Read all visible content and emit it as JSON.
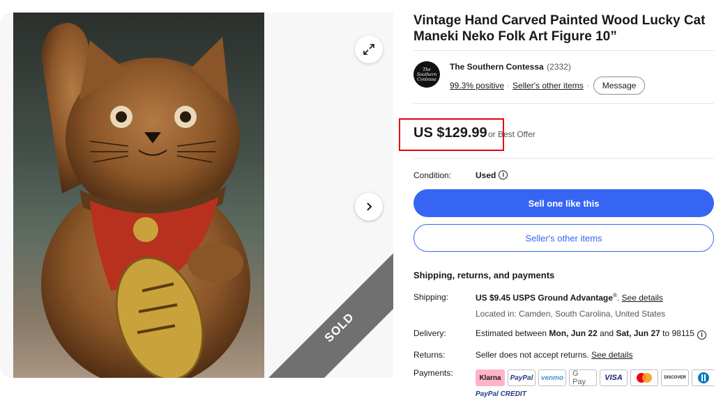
{
  "listing": {
    "title": "Vintage Hand Carved Painted Wood Lucky Cat Maneki Neko Folk Art Figure 10”",
    "sold_label": "SOLD"
  },
  "seller": {
    "logo_text": "The Southern Contessa",
    "name": "The Southern Contessa",
    "feedback_count": "(2332)",
    "positive": "99.3% positive",
    "other_items_link": "Seller's other items",
    "message_button": "Message"
  },
  "price": {
    "amount": "US $129.99",
    "offer_text": "or Best Offer"
  },
  "condition": {
    "label": "Condition:",
    "value": "Used"
  },
  "actions": {
    "sell_one": "Sell one like this",
    "seller_items": "Seller's other items"
  },
  "shipping_section": {
    "title": "Shipping, returns, and payments",
    "shipping_label": "Shipping:",
    "shipping_value": "US $9.45 USPS Ground Advantage",
    "shipping_reg": "®",
    "shipping_period": ".",
    "see_details": "See details",
    "location": "Located in: Camden, South Carolina, United States",
    "delivery_label": "Delivery:",
    "delivery_prefix": "Estimated between ",
    "delivery_start": "Mon, Jun 22",
    "delivery_and": " and ",
    "delivery_end": "Sat, Jun 27",
    "delivery_suffix": " to 98115",
    "returns_label": "Returns:",
    "returns_value": "Seller does not accept returns.",
    "returns_details": "See details",
    "payments_label": "Payments:",
    "payment_methods": [
      "Klarna",
      "PayPal",
      "venmo",
      "G Pay",
      "VISA",
      "Mastercard",
      "DISCOVER",
      "Diners"
    ],
    "paypal_credit": "PayPal CREDIT"
  },
  "icons": {
    "expand": "expand-icon",
    "next": "chevron-right-icon",
    "info": "info-icon"
  },
  "colors": {
    "primary": "#3665f3",
    "highlight": "#e60012",
    "sold_ribbon": "#707070"
  }
}
